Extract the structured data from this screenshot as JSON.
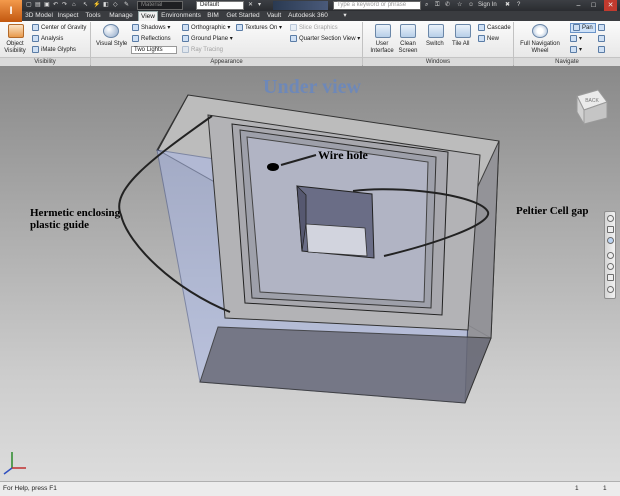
{
  "app": {
    "logo": "I"
  },
  "quick_access": {
    "material": "Material",
    "appearance": "Default",
    "search_placeholder": "Type a keyword or phrase",
    "sign_in": "Sign In"
  },
  "tabs": [
    "3D Model",
    "Inspect",
    "Tools",
    "Manage",
    "View",
    "Environments",
    "BIM",
    "Get Started",
    "Vault",
    "Autodesk 360"
  ],
  "active_tab": "View",
  "ribbon": {
    "visibility": {
      "label": "Visibility",
      "object_visibility": "Object Visibility",
      "center_of_gravity": "Center of Gravity",
      "analysis": "Analysis",
      "imate_glyphs": "iMate Glyphs"
    },
    "appearance": {
      "label": "Appearance",
      "visual_style": "Visual Style",
      "shadows": "Shadows",
      "reflections": "Reflections",
      "lighting": "Two Lights",
      "orthographic": "Orthographic",
      "ground_plane": "Ground Plane",
      "ray_tracing": "Ray Tracing",
      "textures_on": "Textures On",
      "slice_graphics": "Slice Graphics",
      "quarter_section_view": "Quarter Section View"
    },
    "windows": {
      "label": "Windows",
      "user_interface": "User Interface",
      "clean_screen": "Clean Screen",
      "switch": "Switch",
      "tile_all": "Tile All",
      "cascade": "Cascade",
      "new": "New"
    },
    "navigate": {
      "label": "Navigate",
      "full_navigation_wheel": "Full Navigation Wheel",
      "pan": "Pan"
    }
  },
  "viewport": {
    "title": "Under view",
    "annotations": {
      "wire_hole": "Wire hole",
      "hermetic_line1": "Hermetic enclosing",
      "hermetic_line2": "plastic guide",
      "peltier": "Peltier Cell gap"
    },
    "viewcube_label": "BACK"
  },
  "status": {
    "help": "For Help, press F1",
    "count_1": "1",
    "count_2": "1"
  },
  "colors": {
    "title_accent": "#6e88b8",
    "glass_blue": "#aab8e8",
    "ribbon_active": "#f0f0f0"
  }
}
